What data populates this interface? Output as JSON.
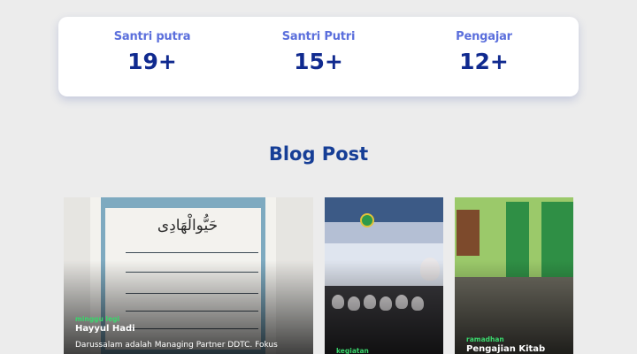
{
  "stats": [
    {
      "label": "Santri putra",
      "value": "19+"
    },
    {
      "label": "Santri Putri",
      "value": "15+"
    },
    {
      "label": "Pengajar",
      "value": "12+"
    }
  ],
  "blog": {
    "title": "Blog Post",
    "posts": [
      {
        "tag": "minggu legi",
        "title": "Hayyul Hadi",
        "excerpt": "Darussalam adalah Managing Partner DDTC. Fokus"
      },
      {
        "tag": "kegiatan",
        "title": "",
        "excerpt": ""
      },
      {
        "tag": "ramadhan",
        "title": "Pengajian Kitab",
        "excerpt": ""
      }
    ],
    "manuscript_heading": "حَيُّوالْهَادِى"
  },
  "colors": {
    "background": "#ececec",
    "stat_label": "#5b6fdc",
    "stat_value": "#102a8f",
    "heading": "#163e96",
    "tag": "#3ad66c"
  }
}
